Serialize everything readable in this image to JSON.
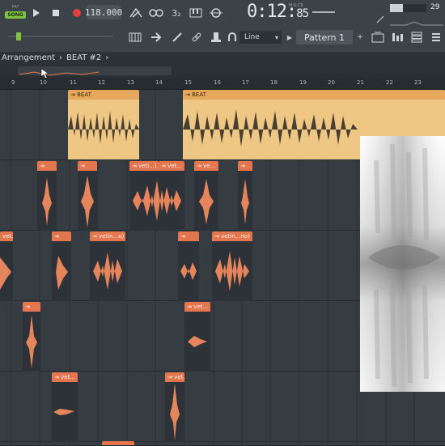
{
  "transport": {
    "pat_label": "PAT",
    "song_label": "SONG",
    "tempo": "118.000",
    "time_main": "0:12:",
    "time_sub": "85",
    "time_format": "M:S:CS",
    "cpu": "29"
  },
  "toolbar2": {
    "snap": "Line",
    "pattern": "Pattern 1"
  },
  "breadcrumb": {
    "window": "Arrangement",
    "separator1": "›",
    "item": "BEAT #2",
    "separator2": "›"
  },
  "ruler": [
    "9",
    "10",
    "11",
    "12",
    "13",
    "14",
    "15",
    "16",
    "17",
    "18",
    "19",
    "20",
    "21",
    "22",
    "23"
  ],
  "clips": {
    "beat1": "BEAT",
    "beat2": "BEAT",
    "r2c1": "",
    "r2c2": "",
    "r2c3": "veti...)",
    "r2c4": "vet...",
    "r2c5": "ve...",
    "r2c6": "",
    "r3c1": "vet...",
    "r3c2": "",
    "r3c3": "vetin...o)",
    "r3c4": "",
    "r3c5": "vetin...no)",
    "r4c1": "",
    "r4c2": "vet...",
    "r5c1": "vet...",
    "r5c2": "vet..."
  },
  "colors": {
    "accent_song": "#7fc241",
    "beat_clip": "#efc785",
    "vox_clip": "#e3764f"
  }
}
